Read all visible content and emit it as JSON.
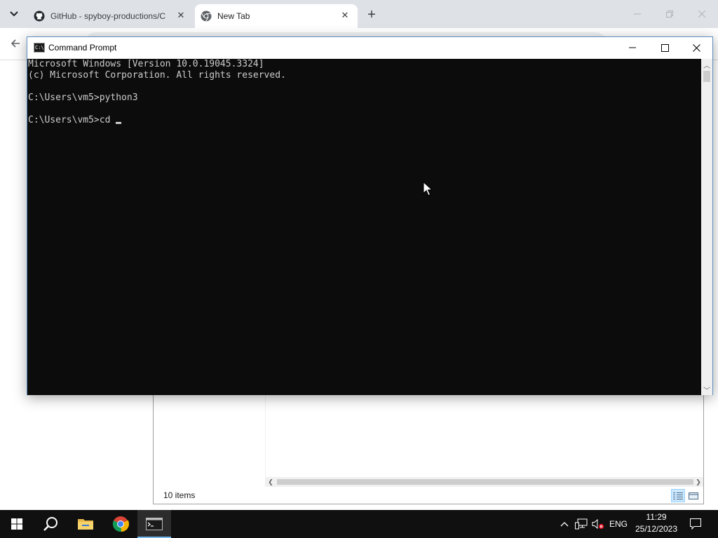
{
  "chrome": {
    "tabs": [
      {
        "title": "GitHub - spyboy-productions/C",
        "favicon": "github-icon"
      },
      {
        "title": "New Tab",
        "favicon": "chrome-icon"
      }
    ]
  },
  "explorer": {
    "status_text": "10 items"
  },
  "cmd": {
    "title": "Command Prompt",
    "lines": [
      "Microsoft Windows [Version 10.0.19045.3324]",
      "(c) Microsoft Corporation. All rights reserved.",
      "",
      "C:\\Users\\vm5>python3",
      "",
      "C:\\Users\\vm5>cd "
    ]
  },
  "taskbar": {
    "language": "ENG",
    "time": "11:29",
    "date": "25/12/2023"
  }
}
